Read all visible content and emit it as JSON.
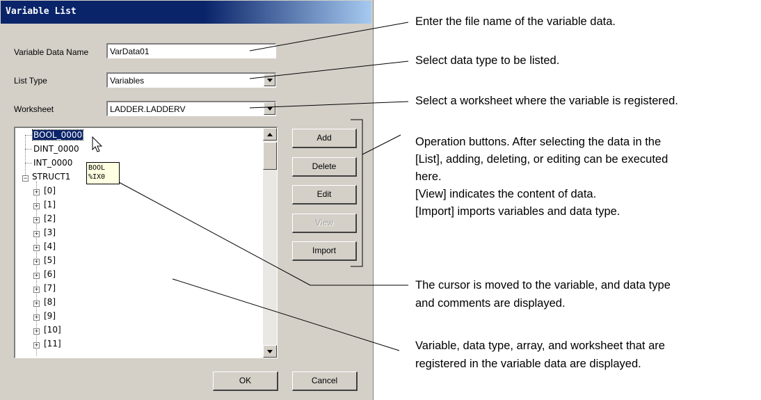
{
  "dialog": {
    "title": "Variable List",
    "variable_data_name": {
      "label": "Variable Data Name",
      "value": "VarData01"
    },
    "list_type": {
      "label": "List Type",
      "value": "Variables"
    },
    "worksheet": {
      "label": "Worksheet",
      "value": "LADDER.LADDERV"
    },
    "tree": {
      "selected": "BOOL_0000",
      "items": [
        "DINT_0000",
        "INT_0000",
        "STRUCT1"
      ],
      "children": [
        "[0]",
        "[1]",
        "[2]",
        "[3]",
        "[4]",
        "[5]",
        "[6]",
        "[7]",
        "[8]",
        "[9]",
        "[10]",
        "[11]"
      ]
    },
    "tooltip": {
      "line1": "BOOL",
      "line2": "%IX0"
    },
    "buttons": {
      "add": "Add",
      "delete": "Delete",
      "edit": "Edit",
      "view": "View",
      "import": "Import",
      "ok": "OK",
      "cancel": "Cancel"
    }
  },
  "annotations": {
    "file_name": "Enter the file name of the variable data.",
    "data_type": "Select data type to be listed.",
    "worksheet": "Select a worksheet where the variable is registered.",
    "operation_lines": [
      "Operation buttons. After selecting the data in the",
      "[List], adding, deleting, or editing can be executed",
      "here.",
      "[View] indicates the content of data.",
      "[Import] imports variables and data type."
    ],
    "cursor_lines": [
      "The cursor is moved to the variable, and data type",
      "and comments are displayed."
    ],
    "variable_lines": [
      "Variable, data type, array, and worksheet that are",
      "registered in the variable data are displayed."
    ]
  }
}
